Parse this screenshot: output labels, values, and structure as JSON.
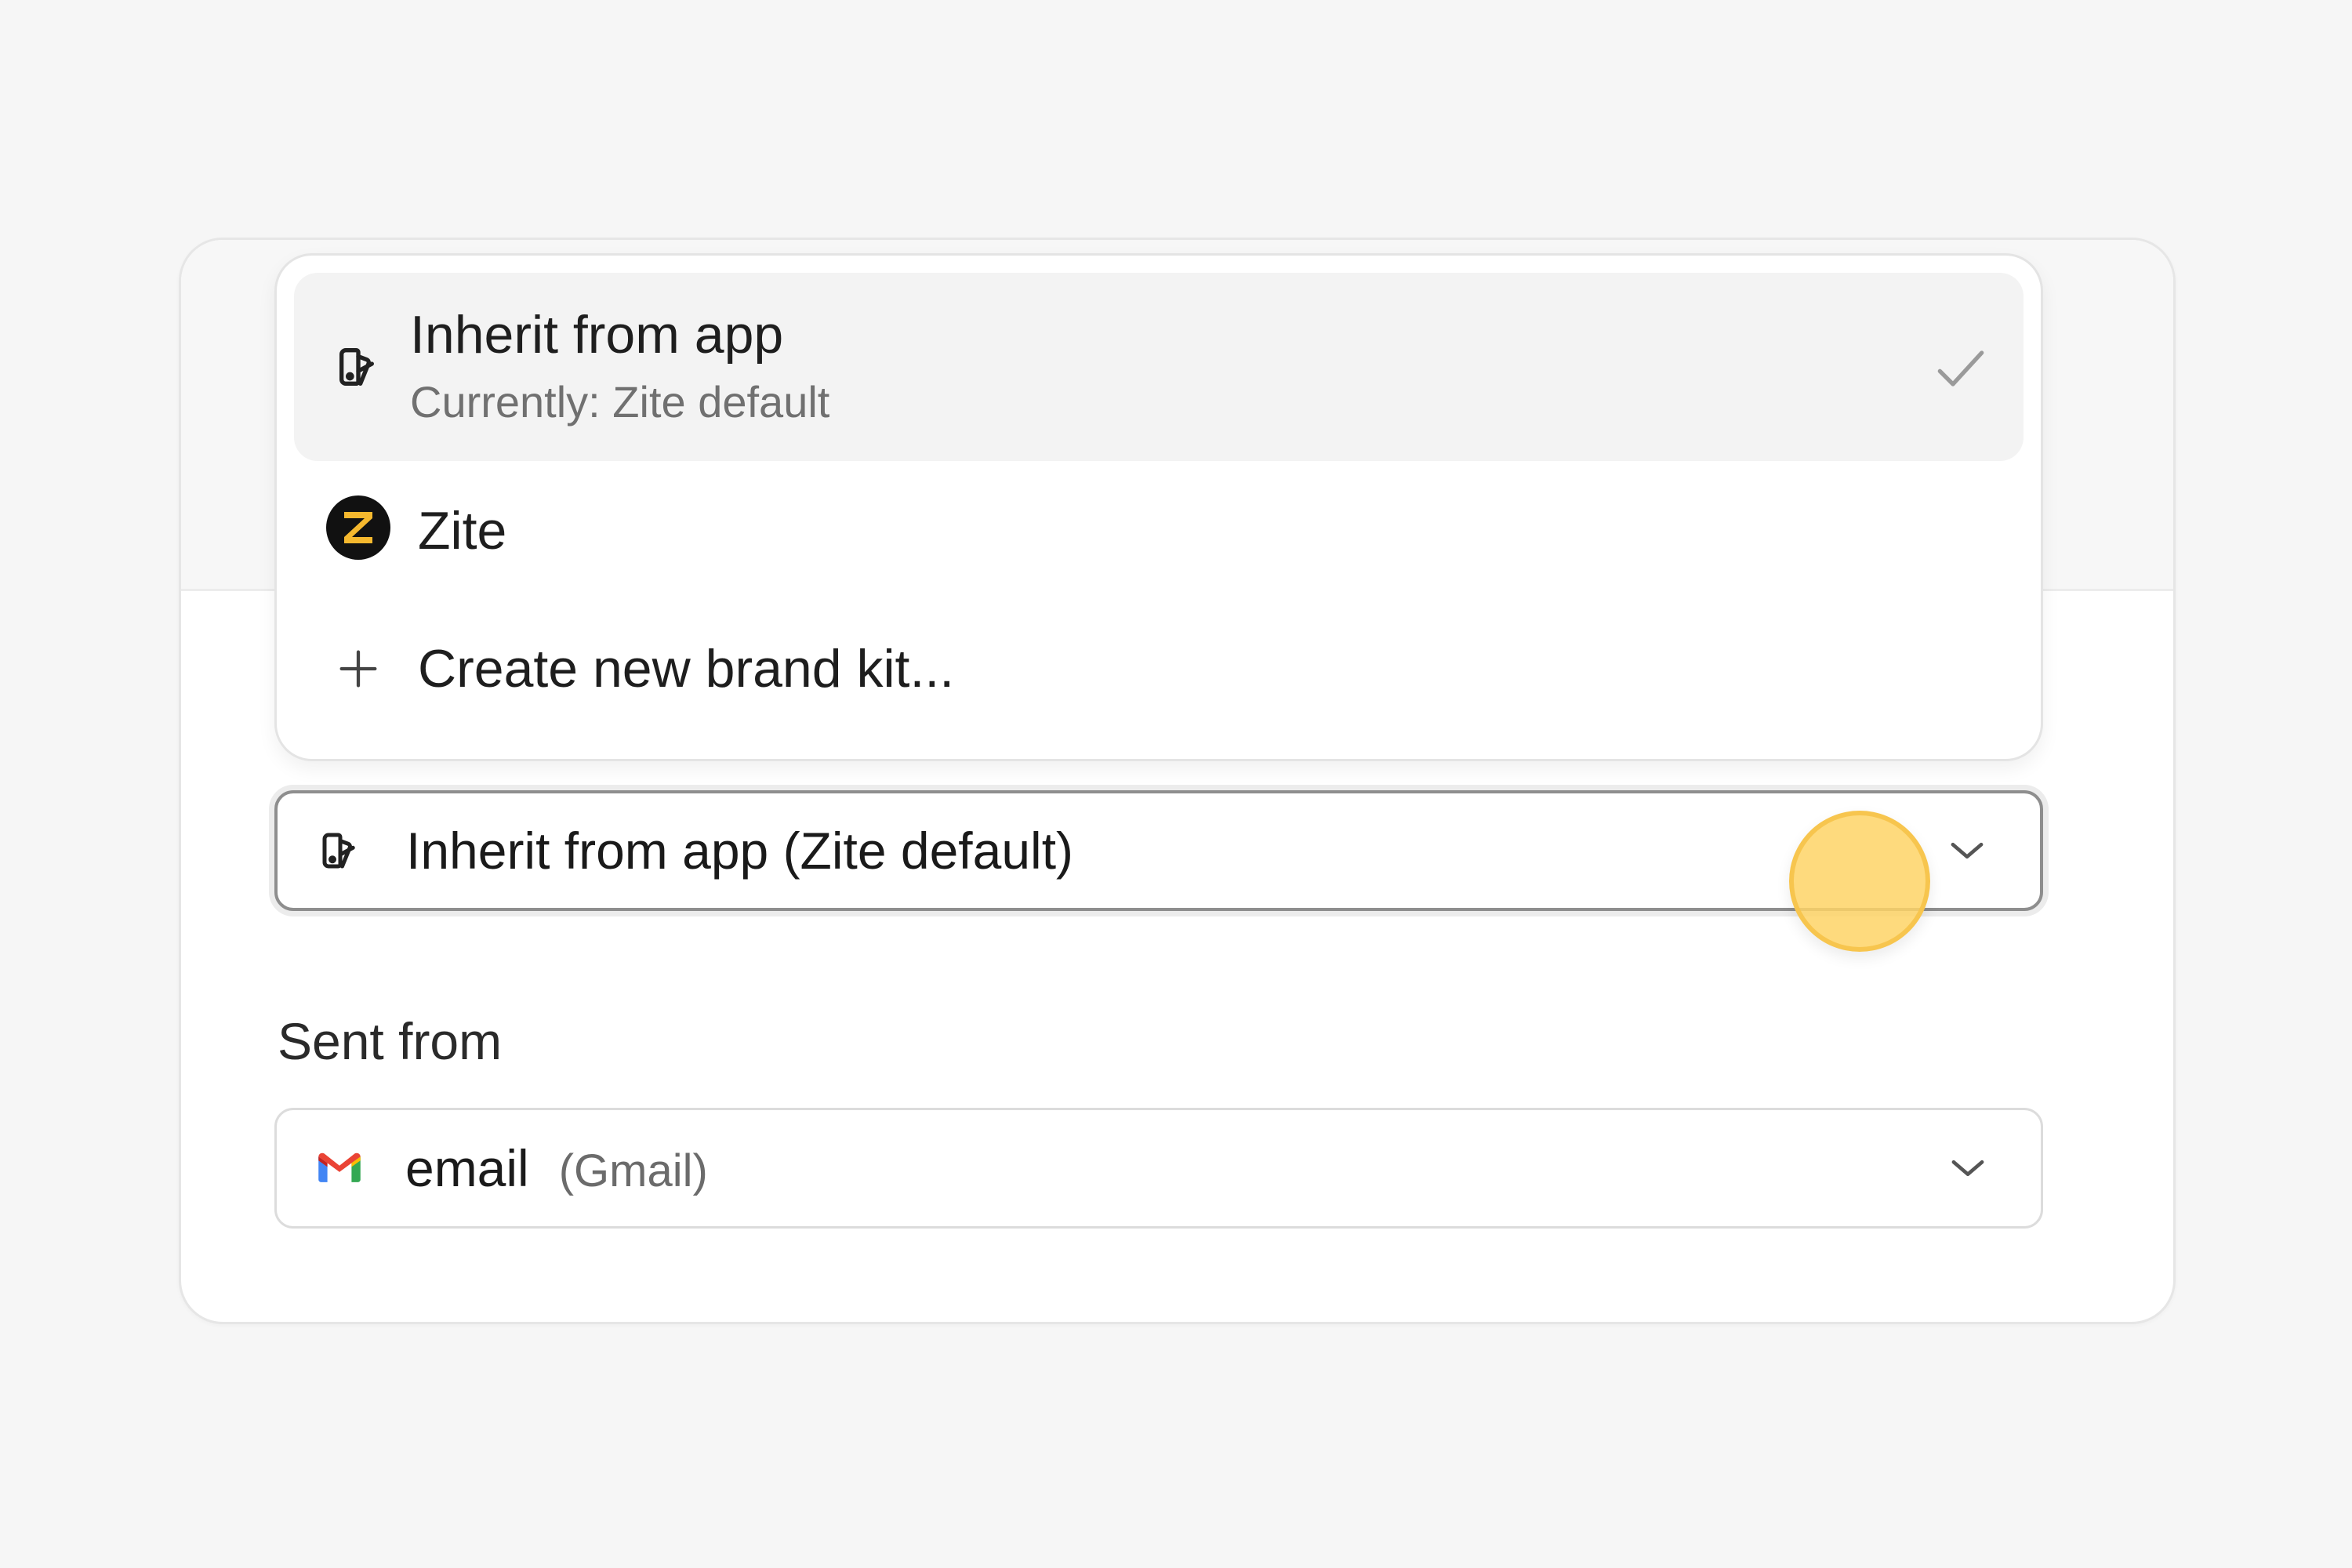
{
  "brand_kit_dropdown": {
    "options": [
      {
        "title": "Inherit from app",
        "subtitle": "Currently: Zite default",
        "icon": "brand-kit-icon",
        "selected": true
      },
      {
        "title": "Zite",
        "icon": "zite-logo-icon",
        "selected": false
      },
      {
        "title": "Create new brand kit...",
        "icon": "plus-icon",
        "selected": false
      }
    ]
  },
  "brand_kit_select": {
    "value": "Inherit from app (Zite default)",
    "icon": "brand-kit-icon"
  },
  "sent_from": {
    "label": "Sent from",
    "value": "email",
    "provider": "(Gmail)",
    "icon": "gmail-icon"
  },
  "colors": {
    "zite_brand": "#f5b82e",
    "cursor_highlight": "#fed466"
  }
}
